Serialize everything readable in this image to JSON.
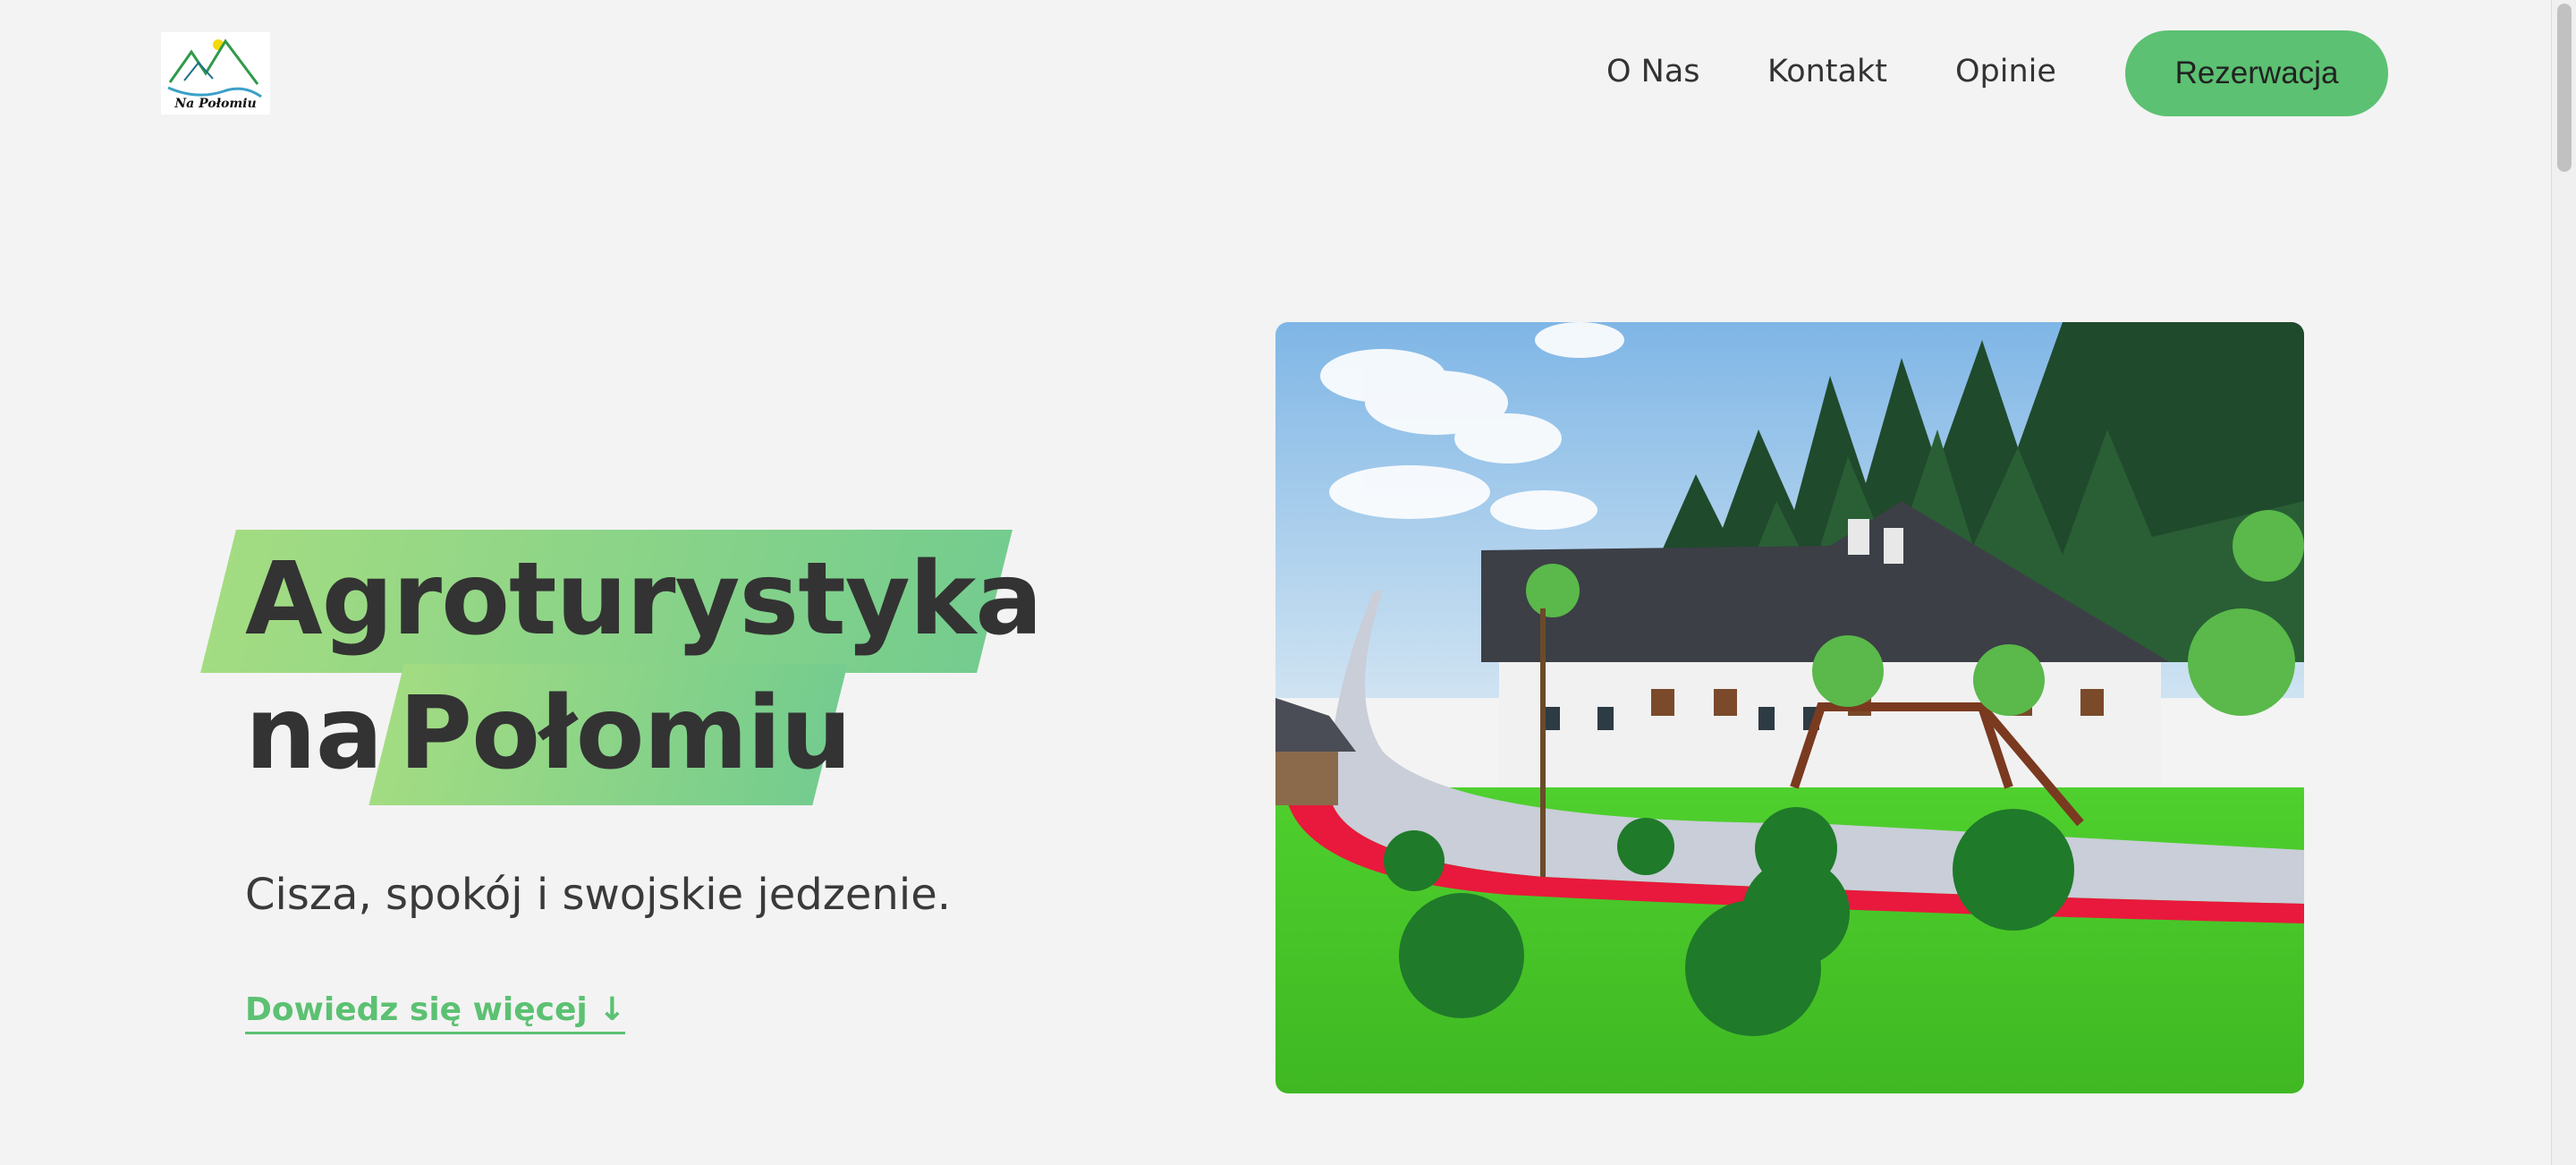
{
  "brand": {
    "logo_caption": "Na Połomiu"
  },
  "nav": {
    "about": "O Nas",
    "contact": "Kontakt",
    "reviews": "Opinie",
    "reserve": "Rezerwacja"
  },
  "hero": {
    "title_line1": "Agroturystyka",
    "title_word_na": "na",
    "title_word_polomiu": "Połomiu",
    "subtitle": "Cisza, spokój i swojskie jedzenie.",
    "cta": "Dowiedz się więcej ↓"
  },
  "colors": {
    "accent": "#5cc172",
    "band_start": "#a3dc82",
    "band_end": "#74cc8e",
    "background": "#f3f3f3",
    "text": "#3a3a3a"
  }
}
